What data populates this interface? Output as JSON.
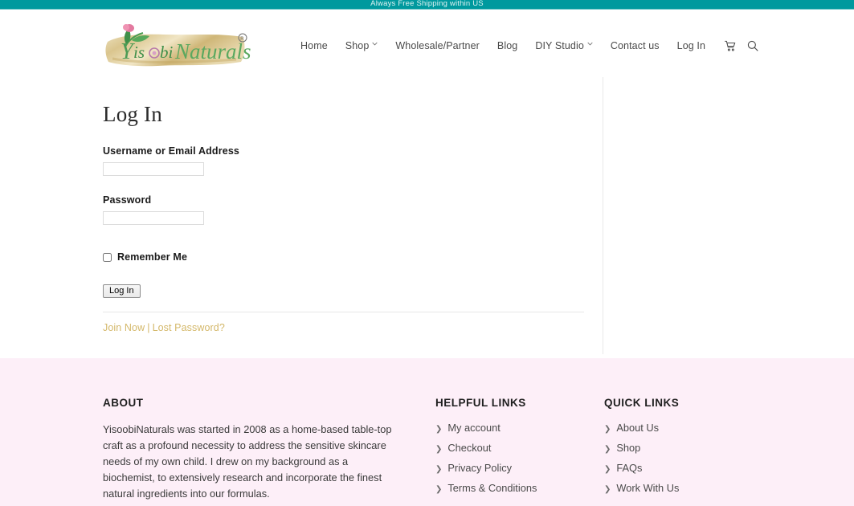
{
  "promo": {
    "text": "Always Free Shipping within US",
    "background": "#00999E",
    "text_color": "#DFF3F3"
  },
  "header": {
    "logo_text": "YisoobiNaturals",
    "logo_mark": "registered-trademark",
    "nav": [
      {
        "label": "Home",
        "has_dropdown": false
      },
      {
        "label": "Shop",
        "has_dropdown": true
      },
      {
        "label": "Wholesale/Partner",
        "has_dropdown": false
      },
      {
        "label": "Blog",
        "has_dropdown": false
      },
      {
        "label": "DIY Studio",
        "has_dropdown": true
      },
      {
        "label": "Contact us",
        "has_dropdown": false
      },
      {
        "label": "Log In",
        "has_dropdown": false
      }
    ],
    "icons": [
      {
        "name": "cart-icon",
        "label": "Cart"
      },
      {
        "name": "search-icon",
        "label": "Search"
      }
    ]
  },
  "login": {
    "title": "Log In",
    "username_label": "Username or Email Address",
    "username_value": "",
    "username_placeholder": "",
    "password_label": "Password",
    "password_value": "",
    "password_placeholder": "",
    "remember_label": "Remember Me",
    "remember_checked": false,
    "submit_label": "Log In",
    "join_link": "Join Now",
    "separator": "|",
    "lost_password_link": "Lost Password?",
    "link_color": "#D4B86A"
  },
  "footer": {
    "background": "#FDEFF8",
    "about": {
      "heading": "ABOUT",
      "text": "YisoobiNaturals was started in 2008 as a home-based table-top craft as a profound necessity to address the sensitive skincare needs of my own child. I drew on my background as a biochemist, to extensively research and incorporate the finest natural ingredients into our formulas."
    },
    "helpful": {
      "heading": "HELPFUL LINKS",
      "links": [
        "My account",
        "Checkout",
        "Privacy Policy",
        "Terms & Conditions"
      ]
    },
    "quick": {
      "heading": "QUICK LINKS",
      "links": [
        "About Us",
        "Shop",
        "FAQs",
        "Work With Us"
      ]
    }
  }
}
